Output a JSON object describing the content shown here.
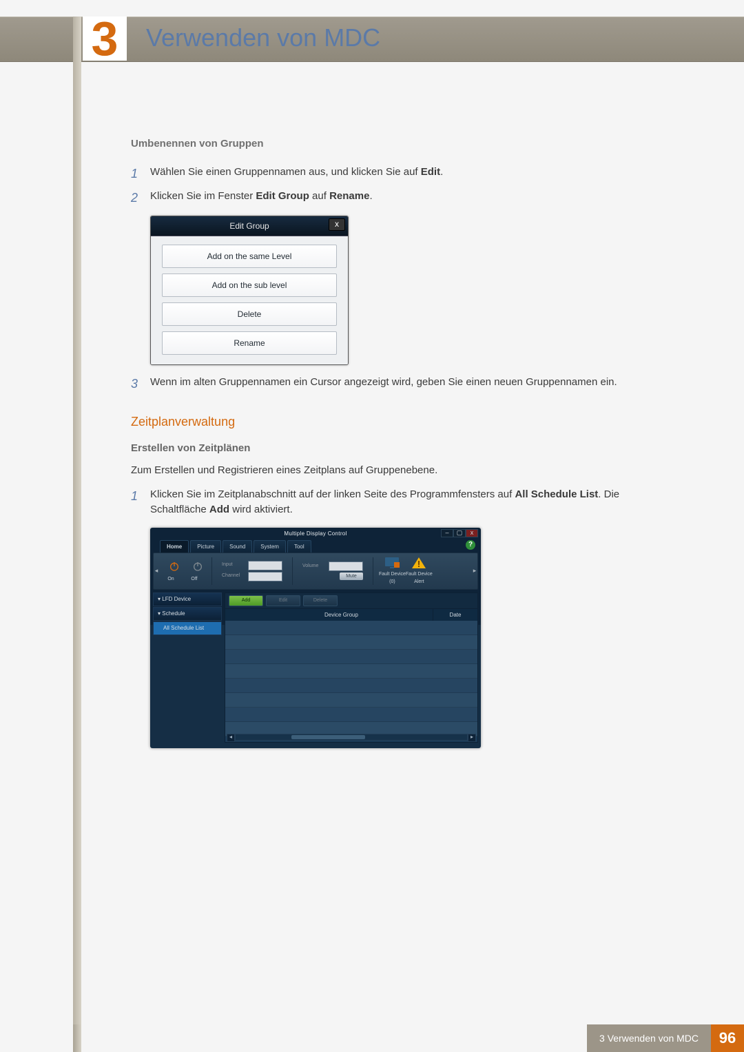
{
  "chapter": {
    "number": "3",
    "title": "Verwenden von MDC"
  },
  "section1": {
    "heading": "Umbenennen von Gruppen",
    "step1_pre": "Wählen Sie einen Gruppennamen aus, und klicken Sie auf ",
    "step1_bold": "Edit",
    "step1_post": ".",
    "step2_pre": "Klicken Sie im Fenster ",
    "step2_b1": "Edit Group",
    "step2_mid": " auf ",
    "step2_b2": "Rename",
    "step2_post": ".",
    "step3": "Wenn im alten Gruppennamen ein Cursor angezeigt wird, geben Sie einen neuen Gruppennamen ein."
  },
  "editGroup": {
    "title": "Edit Group",
    "close": "x",
    "opt1": "Add on the same Level",
    "opt2": "Add on the sub level",
    "opt3": "Delete",
    "opt4": "Rename"
  },
  "section2": {
    "accent": "Zeitplanverwaltung",
    "sub": "Erstellen von Zeitplänen",
    "intro": "Zum Erstellen und Registrieren eines Zeitplans auf Gruppenebene.",
    "step1_pre": "Klicken Sie im Zeitplanabschnitt auf der linken Seite des Programmfensters auf ",
    "step1_b1": "All Schedule List",
    "step1_mid": ". Die Schaltfläche ",
    "step1_b2": "Add",
    "step1_post": " wird aktiviert."
  },
  "mdc": {
    "title": "Multiple Display Control",
    "help": "?",
    "win_min": "–",
    "win_max": "▢",
    "win_close": "x",
    "tabs": {
      "home": "Home",
      "picture": "Picture",
      "sound": "Sound",
      "system": "System",
      "tool": "Tool"
    },
    "ribbon": {
      "on": "On",
      "off": "Off",
      "input": "Input",
      "channel": "Channel",
      "volume": "Volume",
      "mute": "Mute",
      "fd0": "Fault Device\n(0)",
      "fda": "Fault Device\nAlert"
    },
    "tree": {
      "lfd": "LFD Device",
      "sched": "Schedule",
      "all": "All Schedule List"
    },
    "grid": {
      "add": "Add",
      "edit": "Edit",
      "delete": "Delete",
      "colGroup": "Device Group",
      "colDate": "Date"
    },
    "scroll": {
      "left": "◂",
      "right": "▸"
    }
  },
  "footer": {
    "label": "3 Verwenden von MDC",
    "page": "96"
  }
}
